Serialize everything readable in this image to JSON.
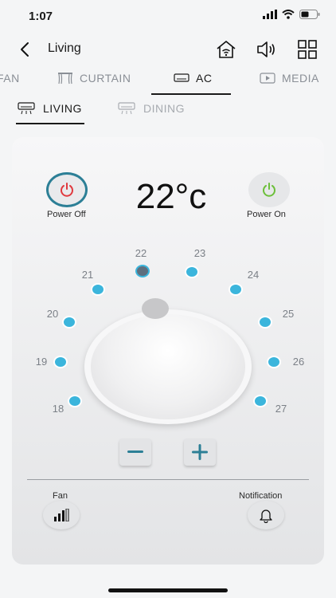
{
  "status": {
    "time": "1:07"
  },
  "nav": {
    "title": "Living"
  },
  "tabs": [
    {
      "label": "FAN"
    },
    {
      "label": "CURTAIN"
    },
    {
      "label": "AC"
    },
    {
      "label": "MEDIA"
    }
  ],
  "subtabs": [
    {
      "label": "LIVING"
    },
    {
      "label": "DINING"
    }
  ],
  "ac": {
    "temperature": "22°c",
    "power_off_label": "Power Off",
    "power_on_label": "Power On",
    "selected_temp": 22,
    "scale": [
      "18",
      "19",
      "20",
      "21",
      "22",
      "23",
      "24",
      "25",
      "26",
      "27"
    ]
  },
  "bottom": {
    "fan_label": "Fan",
    "notification_label": "Notification"
  },
  "colors": {
    "accent": "#3bb5dc",
    "power_off": "#e0393e",
    "power_on": "#6cbf3a",
    "ring": "#2c7f96"
  }
}
